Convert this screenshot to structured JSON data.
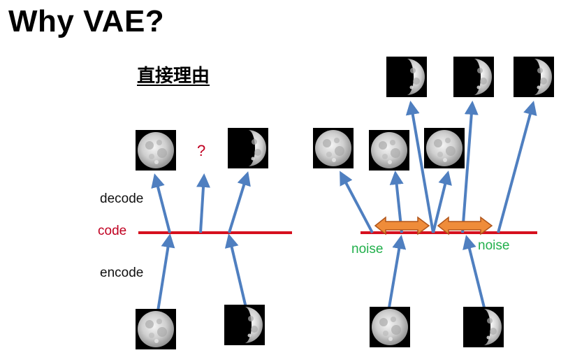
{
  "slide": {
    "title": "Why VAE?",
    "subtitle": "直接理由"
  },
  "labels": {
    "decode": "decode",
    "code": "code",
    "encode": "encode",
    "question": "?",
    "noise_left": "noise",
    "noise_right": "noise"
  },
  "colors": {
    "arrow": "#4f7fc0",
    "code_line": "#d6101e",
    "noise_arrow_fill": "#ef8c3a",
    "noise_arrow_stroke": "#b0551a",
    "noise_text": "#22b04c",
    "code_text": "#c00021"
  }
}
